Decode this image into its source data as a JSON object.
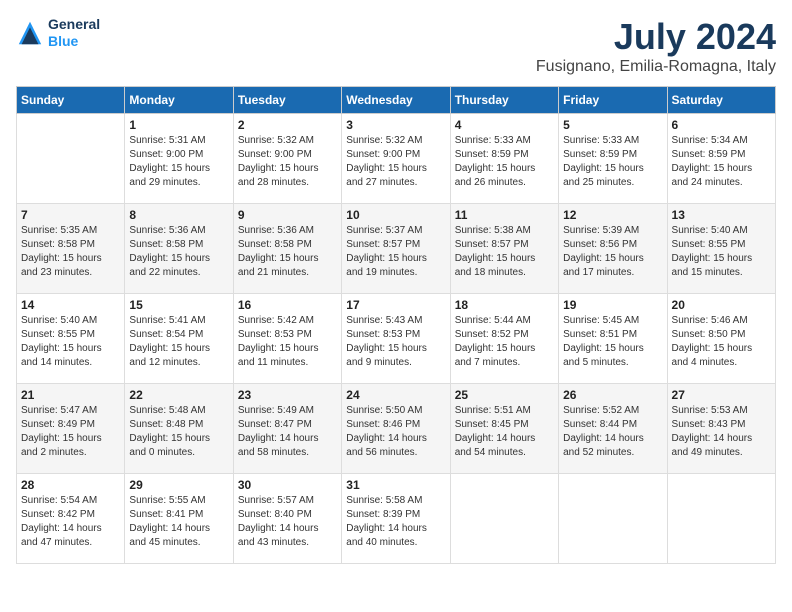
{
  "logo": {
    "line1": "General",
    "line2": "Blue"
  },
  "title": "July 2024",
  "location": "Fusignano, Emilia-Romagna, Italy",
  "days_of_week": [
    "Sunday",
    "Monday",
    "Tuesday",
    "Wednesday",
    "Thursday",
    "Friday",
    "Saturday"
  ],
  "weeks": [
    [
      {
        "day": "",
        "sunrise": "",
        "sunset": "",
        "daylight": ""
      },
      {
        "day": "1",
        "sunrise": "Sunrise: 5:31 AM",
        "sunset": "Sunset: 9:00 PM",
        "daylight": "Daylight: 15 hours and 29 minutes."
      },
      {
        "day": "2",
        "sunrise": "Sunrise: 5:32 AM",
        "sunset": "Sunset: 9:00 PM",
        "daylight": "Daylight: 15 hours and 28 minutes."
      },
      {
        "day": "3",
        "sunrise": "Sunrise: 5:32 AM",
        "sunset": "Sunset: 9:00 PM",
        "daylight": "Daylight: 15 hours and 27 minutes."
      },
      {
        "day": "4",
        "sunrise": "Sunrise: 5:33 AM",
        "sunset": "Sunset: 8:59 PM",
        "daylight": "Daylight: 15 hours and 26 minutes."
      },
      {
        "day": "5",
        "sunrise": "Sunrise: 5:33 AM",
        "sunset": "Sunset: 8:59 PM",
        "daylight": "Daylight: 15 hours and 25 minutes."
      },
      {
        "day": "6",
        "sunrise": "Sunrise: 5:34 AM",
        "sunset": "Sunset: 8:59 PM",
        "daylight": "Daylight: 15 hours and 24 minutes."
      }
    ],
    [
      {
        "day": "7",
        "sunrise": "Sunrise: 5:35 AM",
        "sunset": "Sunset: 8:58 PM",
        "daylight": "Daylight: 15 hours and 23 minutes."
      },
      {
        "day": "8",
        "sunrise": "Sunrise: 5:36 AM",
        "sunset": "Sunset: 8:58 PM",
        "daylight": "Daylight: 15 hours and 22 minutes."
      },
      {
        "day": "9",
        "sunrise": "Sunrise: 5:36 AM",
        "sunset": "Sunset: 8:58 PM",
        "daylight": "Daylight: 15 hours and 21 minutes."
      },
      {
        "day": "10",
        "sunrise": "Sunrise: 5:37 AM",
        "sunset": "Sunset: 8:57 PM",
        "daylight": "Daylight: 15 hours and 19 minutes."
      },
      {
        "day": "11",
        "sunrise": "Sunrise: 5:38 AM",
        "sunset": "Sunset: 8:57 PM",
        "daylight": "Daylight: 15 hours and 18 minutes."
      },
      {
        "day": "12",
        "sunrise": "Sunrise: 5:39 AM",
        "sunset": "Sunset: 8:56 PM",
        "daylight": "Daylight: 15 hours and 17 minutes."
      },
      {
        "day": "13",
        "sunrise": "Sunrise: 5:40 AM",
        "sunset": "Sunset: 8:55 PM",
        "daylight": "Daylight: 15 hours and 15 minutes."
      }
    ],
    [
      {
        "day": "14",
        "sunrise": "Sunrise: 5:40 AM",
        "sunset": "Sunset: 8:55 PM",
        "daylight": "Daylight: 15 hours and 14 minutes."
      },
      {
        "day": "15",
        "sunrise": "Sunrise: 5:41 AM",
        "sunset": "Sunset: 8:54 PM",
        "daylight": "Daylight: 15 hours and 12 minutes."
      },
      {
        "day": "16",
        "sunrise": "Sunrise: 5:42 AM",
        "sunset": "Sunset: 8:53 PM",
        "daylight": "Daylight: 15 hours and 11 minutes."
      },
      {
        "day": "17",
        "sunrise": "Sunrise: 5:43 AM",
        "sunset": "Sunset: 8:53 PM",
        "daylight": "Daylight: 15 hours and 9 minutes."
      },
      {
        "day": "18",
        "sunrise": "Sunrise: 5:44 AM",
        "sunset": "Sunset: 8:52 PM",
        "daylight": "Daylight: 15 hours and 7 minutes."
      },
      {
        "day": "19",
        "sunrise": "Sunrise: 5:45 AM",
        "sunset": "Sunset: 8:51 PM",
        "daylight": "Daylight: 15 hours and 5 minutes."
      },
      {
        "day": "20",
        "sunrise": "Sunrise: 5:46 AM",
        "sunset": "Sunset: 8:50 PM",
        "daylight": "Daylight: 15 hours and 4 minutes."
      }
    ],
    [
      {
        "day": "21",
        "sunrise": "Sunrise: 5:47 AM",
        "sunset": "Sunset: 8:49 PM",
        "daylight": "Daylight: 15 hours and 2 minutes."
      },
      {
        "day": "22",
        "sunrise": "Sunrise: 5:48 AM",
        "sunset": "Sunset: 8:48 PM",
        "daylight": "Daylight: 15 hours and 0 minutes."
      },
      {
        "day": "23",
        "sunrise": "Sunrise: 5:49 AM",
        "sunset": "Sunset: 8:47 PM",
        "daylight": "Daylight: 14 hours and 58 minutes."
      },
      {
        "day": "24",
        "sunrise": "Sunrise: 5:50 AM",
        "sunset": "Sunset: 8:46 PM",
        "daylight": "Daylight: 14 hours and 56 minutes."
      },
      {
        "day": "25",
        "sunrise": "Sunrise: 5:51 AM",
        "sunset": "Sunset: 8:45 PM",
        "daylight": "Daylight: 14 hours and 54 minutes."
      },
      {
        "day": "26",
        "sunrise": "Sunrise: 5:52 AM",
        "sunset": "Sunset: 8:44 PM",
        "daylight": "Daylight: 14 hours and 52 minutes."
      },
      {
        "day": "27",
        "sunrise": "Sunrise: 5:53 AM",
        "sunset": "Sunset: 8:43 PM",
        "daylight": "Daylight: 14 hours and 49 minutes."
      }
    ],
    [
      {
        "day": "28",
        "sunrise": "Sunrise: 5:54 AM",
        "sunset": "Sunset: 8:42 PM",
        "daylight": "Daylight: 14 hours and 47 minutes."
      },
      {
        "day": "29",
        "sunrise": "Sunrise: 5:55 AM",
        "sunset": "Sunset: 8:41 PM",
        "daylight": "Daylight: 14 hours and 45 minutes."
      },
      {
        "day": "30",
        "sunrise": "Sunrise: 5:57 AM",
        "sunset": "Sunset: 8:40 PM",
        "daylight": "Daylight: 14 hours and 43 minutes."
      },
      {
        "day": "31",
        "sunrise": "Sunrise: 5:58 AM",
        "sunset": "Sunset: 8:39 PM",
        "daylight": "Daylight: 14 hours and 40 minutes."
      },
      {
        "day": "",
        "sunrise": "",
        "sunset": "",
        "daylight": ""
      },
      {
        "day": "",
        "sunrise": "",
        "sunset": "",
        "daylight": ""
      },
      {
        "day": "",
        "sunrise": "",
        "sunset": "",
        "daylight": ""
      }
    ]
  ]
}
